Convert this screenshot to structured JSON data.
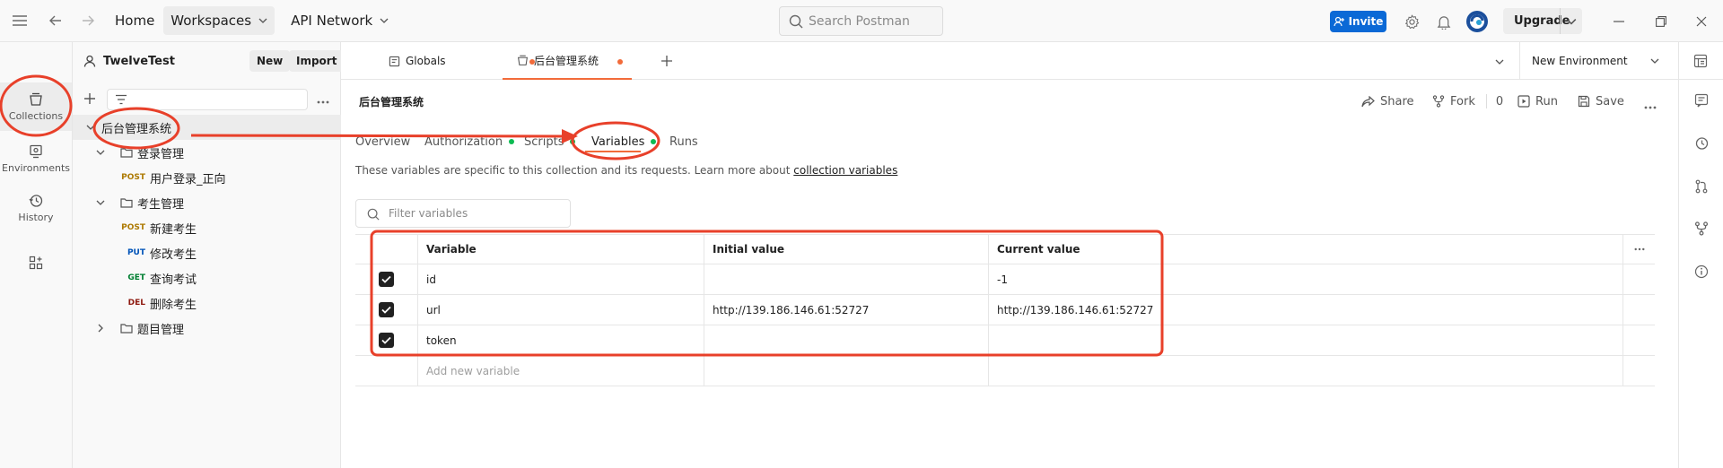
{
  "topbar": {
    "home": "Home",
    "workspaces": "Workspaces",
    "api_network": "API Network",
    "search_placeholder": "Search Postman",
    "invite": "Invite",
    "upgrade": "Upgrade"
  },
  "rail": {
    "items": [
      {
        "label": "Collections",
        "icon": "collections-icon"
      },
      {
        "label": "Environments",
        "icon": "environments-icon"
      },
      {
        "label": "History",
        "icon": "history-icon"
      }
    ]
  },
  "sidebar": {
    "workspace": "TwelveTest",
    "new": "New",
    "import": "Import",
    "tree": [
      {
        "label": "后台管理系统",
        "type": "collection"
      },
      {
        "label": "登录管理",
        "type": "folder"
      },
      {
        "label": "用户登录_正向",
        "type": "request",
        "method": "POST",
        "method_color": "#ad7a03"
      },
      {
        "label": "考生管理",
        "type": "folder"
      },
      {
        "label": "新建考生",
        "type": "request",
        "method": "POST",
        "method_color": "#ad7a03"
      },
      {
        "label": "修改考生",
        "type": "request",
        "method": "PUT",
        "method_color": "#0053b8"
      },
      {
        "label": "查询考试",
        "type": "request",
        "method": "GET",
        "method_color": "#007f31"
      },
      {
        "label": "删除考生",
        "type": "request",
        "method": "DEL",
        "method_color": "#8e1a10"
      },
      {
        "label": "题目管理",
        "type": "folder"
      }
    ]
  },
  "tabs": [
    {
      "label": "Globals"
    },
    {
      "label": "后台管理系统"
    }
  ],
  "environment": "New Environment",
  "main": {
    "title": "后台管理系统",
    "actions": {
      "share": "Share",
      "fork": "Fork",
      "fork_count": "0",
      "run": "Run",
      "save": "Save"
    },
    "subtabs": [
      "Overview",
      "Authorization",
      "Scripts",
      "Variables",
      "Runs"
    ],
    "description": "These variables are specific to this collection and its requests. Learn more about ",
    "description_link": "collection variables",
    "filter_placeholder": "Filter variables",
    "table": {
      "headers": [
        "Variable",
        "Initial value",
        "Current value"
      ],
      "rows": [
        {
          "variable": "id",
          "initial": "",
          "current": "-1"
        },
        {
          "variable": "url",
          "initial": "http://139.186.146.61:52727",
          "current": "http://139.186.146.61:52727"
        },
        {
          "variable": "token",
          "initial": "",
          "current": ""
        }
      ],
      "add_placeholder": "Add new variable"
    }
  },
  "colors": {
    "accent": "#f26b3a",
    "annotation": "#e8402a",
    "invite": "#0b69d6",
    "enabled_dot": "#0cbb52"
  }
}
